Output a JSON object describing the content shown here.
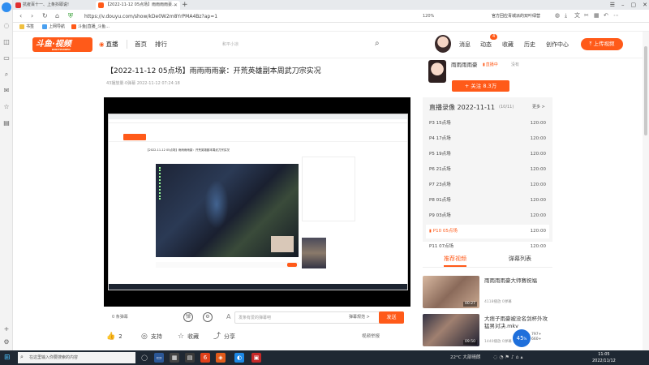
{
  "browser": {
    "tabs": [
      {
        "label": "抗疫百十一、上条抖耶说!"
      },
      {
        "label": "【2022-11-12 05点场】雨雨雨雨豪…"
      }
    ],
    "url": "https://v.douyu.com/show/kDe0W2m8YrPMA4Bz?ap=1",
    "zoom": "120%",
    "promo": "官方回应青城派的双叶绿营",
    "bookmarks": [
      "书签",
      "上网导航",
      "斗鱼|直播_斗鱼..."
    ]
  },
  "site": {
    "logo": "斗鱼·视频",
    "logo_sub": "DOUYUVIDEO",
    "nav": {
      "live": "直播",
      "home": "首页",
      "rank": "排行"
    },
    "search_placeholder": "和平小凉",
    "header": {
      "messages": "消息",
      "dynamics": "动态",
      "dynamics_badge": "4",
      "favorites": "收藏",
      "history": "历史",
      "creator": "创作中心",
      "upload": "上传视频"
    }
  },
  "video": {
    "title": "【2022-11-12 05点场】雨雨雨雨豪：开荒英雄副本周武刀宗实况",
    "meta": "43播放量·0弹幕   2022-11-12 07:24:18",
    "danmaku_count": "0 条弹幕",
    "danmaku_placeholder": "发条有爱的弹幕吧",
    "danmaku_settings": "弹幕规范 >",
    "send": "发送",
    "likes": "2",
    "support": "支持",
    "favorite": "收藏",
    "share": "分享",
    "report": "视频举报"
  },
  "inner": {
    "title": "【2022-11-12 05点场】雨雨雨雨豪：开荒英雄副本周武刀宗实况"
  },
  "author": {
    "name": "雨雨雨雨豪",
    "live_status": "直播中",
    "not_live": "没有",
    "follow": "+ 关注  8.3万"
  },
  "playlist": {
    "title": "直播录像 2022-11-11",
    "count": "(10/11)",
    "more": "更多 >",
    "items": [
      {
        "name": "P3 15点场",
        "duration": "120:00"
      },
      {
        "name": "P4 17点场",
        "duration": "120:00"
      },
      {
        "name": "P5 19点场",
        "duration": "120:00"
      },
      {
        "name": "P6 21点场",
        "duration": "120:00"
      },
      {
        "name": "P7 23点场",
        "duration": "120:00"
      },
      {
        "name": "P8 01点场",
        "duration": "120:00"
      },
      {
        "name": "P9 03点场",
        "duration": "120:00"
      },
      {
        "name": "P10 05点场",
        "duration": "120:00",
        "active": true
      },
      {
        "name": "P11 07点场",
        "duration": "120:00"
      }
    ]
  },
  "right_tabs": {
    "recommended": "推荐视频",
    "danmaku_list": "弹幕列表"
  },
  "recommendations": [
    {
      "title": "雨雨雨雨豪大师赛祝福",
      "meta": "4118播放   0弹幕",
      "duration": "00:27"
    },
    {
      "title": "大痞子雨豪被没名剑杯外攻猛男对决.mkv",
      "meta": "1440播放   0弹幕",
      "duration": "09:50"
    }
  ],
  "speed": {
    "value": "45",
    "unit": "%",
    "up": "797+",
    "down": "660+"
  },
  "taskbar": {
    "search_placeholder": "在这里输入你要搜索的内容",
    "weather": "22°C  大部晴朗",
    "time": "11:05",
    "date": "2022/11/12"
  },
  "colors": {
    "accent": "#ff5a19",
    "taskbar": "#1f2833"
  }
}
